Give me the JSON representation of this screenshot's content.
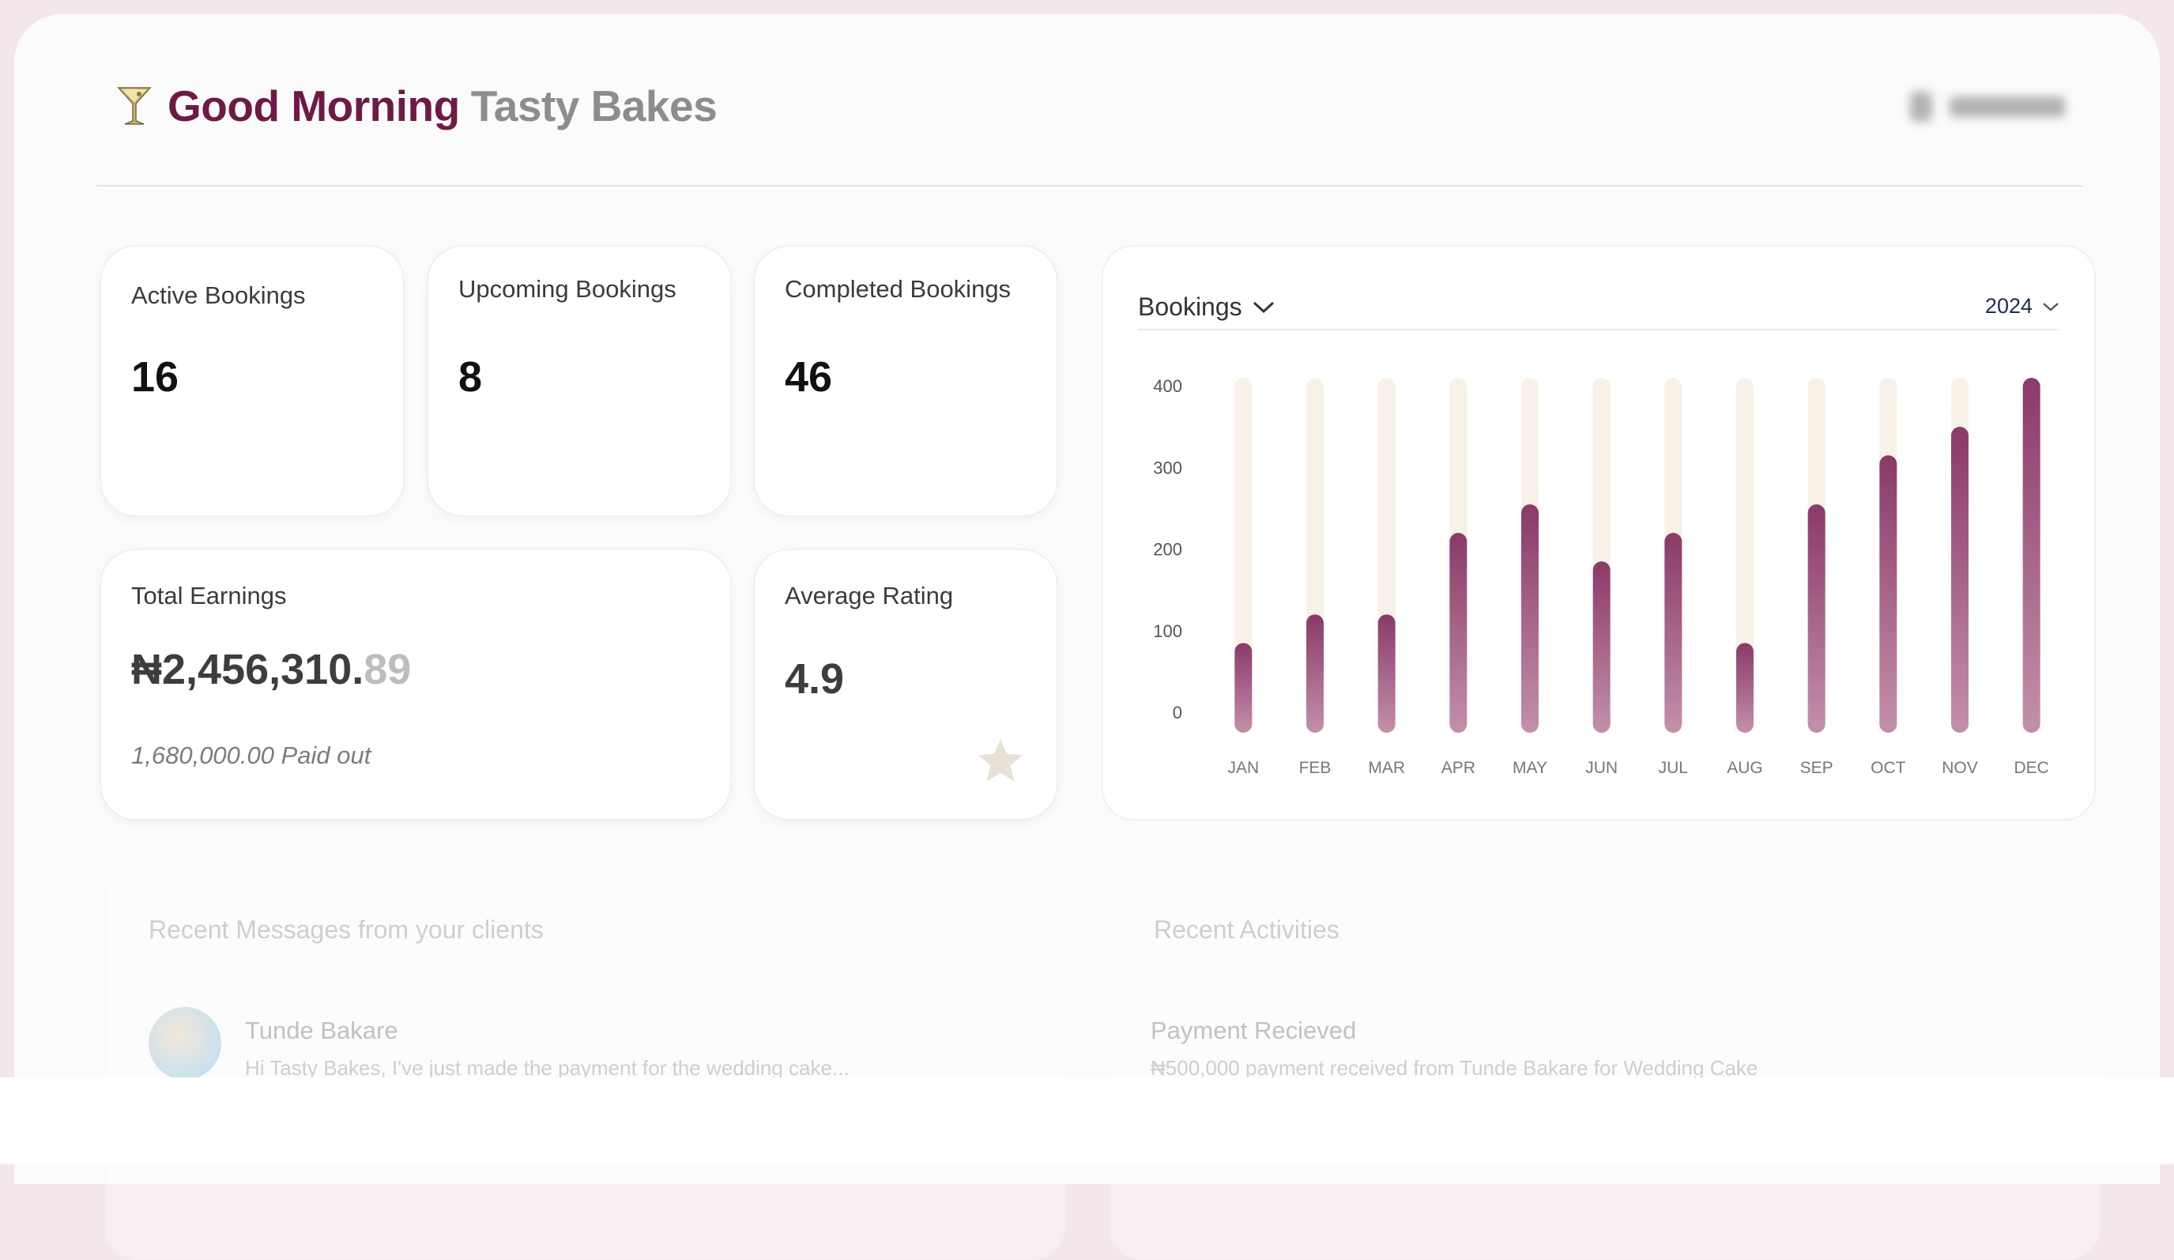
{
  "header": {
    "greeting": "Good Morning",
    "business_name": "Tasty Bakes"
  },
  "stats": {
    "active": {
      "label": "Active Bookings",
      "value": "16"
    },
    "upcoming": {
      "label": "Upcoming Bookings",
      "value": "8"
    },
    "completed": {
      "label": "Completed Bookings",
      "value": "46"
    },
    "earnings": {
      "label": "Total Earnings",
      "value_main": "₦2,456,310.",
      "value_decimals": "89",
      "paid_out": "1,680,000.00 Paid out"
    },
    "rating": {
      "label": "Average Rating",
      "value": "4.9"
    }
  },
  "chart_panel": {
    "title": "Bookings",
    "year": "2024"
  },
  "chart_data": {
    "type": "bar",
    "title": "Bookings",
    "categories": [
      "JAN",
      "FEB",
      "MAR",
      "APR",
      "MAY",
      "JUN",
      "JUL",
      "AUG",
      "SEP",
      "OCT",
      "NOV",
      "DEC"
    ],
    "values": [
      110,
      145,
      145,
      245,
      280,
      210,
      245,
      110,
      280,
      340,
      375,
      435
    ],
    "yticks": [
      0,
      100,
      200,
      300,
      400
    ],
    "ylim": [
      0,
      435
    ],
    "grid": false,
    "colors": {
      "bar": "#8a3a68",
      "bar_light": "#c390ab",
      "track": "#f7f1e8"
    }
  },
  "messages": {
    "title": "Recent Messages from your clients",
    "items": [
      {
        "name": "Tunde Bakare",
        "preview": "Hi Tasty Bakes, I've just made the payment for the wedding cake..."
      }
    ]
  },
  "activities": {
    "title": "Recent Activities",
    "items": [
      {
        "title": "Payment Recieved",
        "detail": "₦500,000 payment received from Tunde Bakare for Wedding Cake"
      }
    ]
  },
  "colors": {
    "brand": "#6e1a45",
    "muted": "#8d8d8d",
    "star": "#e8e2d6"
  }
}
